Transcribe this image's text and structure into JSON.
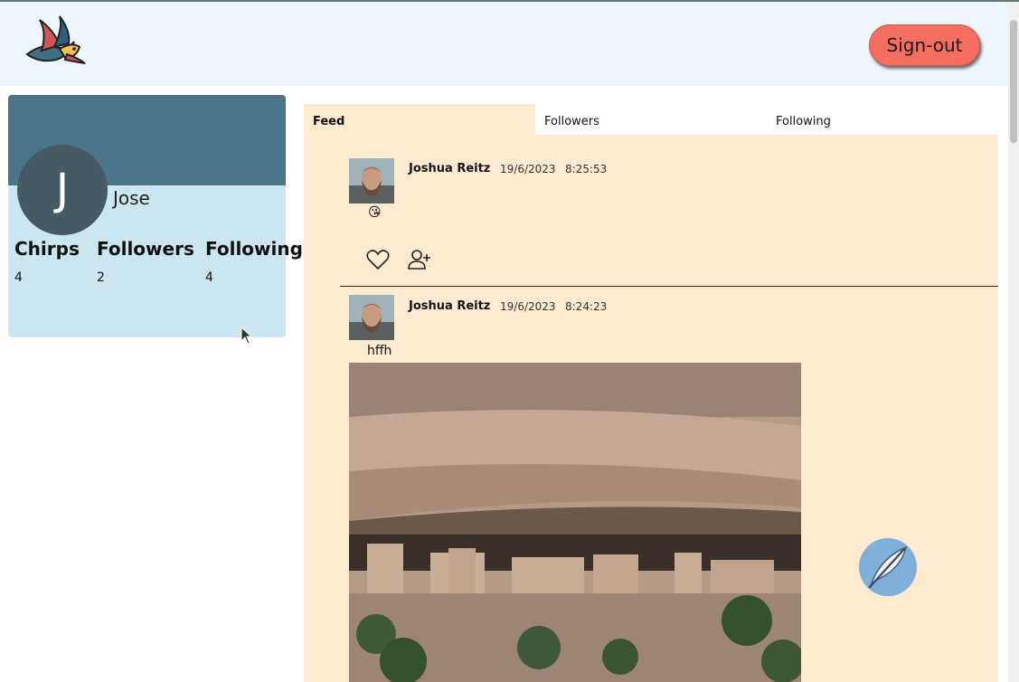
{
  "header": {
    "logo_icon": "swallow-bird-logo",
    "signout_label": "Sign-out"
  },
  "profile": {
    "avatar_initial": "J",
    "name": "Jose",
    "stats": [
      {
        "label": "Chirps",
        "value": "4"
      },
      {
        "label": "Followers",
        "value": "2"
      },
      {
        "label": "Following",
        "value": "4"
      }
    ]
  },
  "tabs": [
    {
      "label": "Feed",
      "active": true
    },
    {
      "label": "Followers",
      "active": false
    },
    {
      "label": "Following",
      "active": false
    }
  ],
  "posts": [
    {
      "author": "Joshua Reitz",
      "date": "19/6/2023",
      "time": "8:25:53",
      "text": "😘",
      "actions": [
        "heart-icon",
        "add-user-icon"
      ]
    },
    {
      "author": "Joshua Reitz",
      "date": "19/6/2023",
      "time": "8:24:23",
      "text": "hffh",
      "image": "cliff-dwelling-photo"
    }
  ],
  "compose_icon": "feather-quill-icon",
  "colors": {
    "header_bg": "#eef6fd",
    "signout_bg": "#f56e5f",
    "profile_card_bg": "#cbe5f1",
    "profile_banner_bg": "#4a7489",
    "avatar_bg": "#455a64",
    "feed_bg": "#feead0",
    "compose_bg": "#7fb0da"
  }
}
